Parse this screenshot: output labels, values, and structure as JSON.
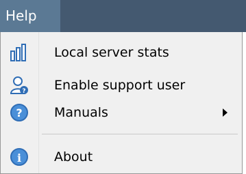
{
  "menubar": {
    "help_label": "Help"
  },
  "menu": {
    "items": [
      {
        "label": "Local server stats",
        "icon": "bar-chart-icon"
      },
      {
        "label": "Enable support user",
        "icon": "user-help-icon"
      },
      {
        "label": "Manuals",
        "icon": "question-icon",
        "has_submenu": true
      },
      {
        "label": "About",
        "icon": "info-icon"
      }
    ]
  },
  "colors": {
    "menubar_bg": "#445970",
    "active_menu_bg": "#5b7994",
    "menu_bg": "#f0f0f0",
    "icon_blue": "#2f6db5"
  }
}
